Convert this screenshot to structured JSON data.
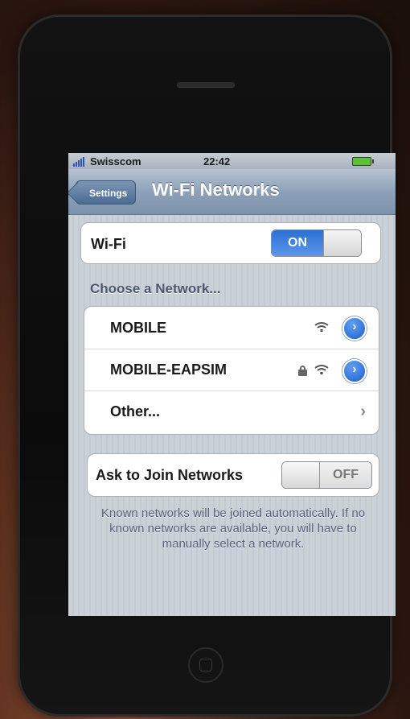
{
  "status_bar": {
    "carrier": "Swisscom",
    "time": "22:42"
  },
  "nav": {
    "back_label": "Settings",
    "title": "Wi-Fi Networks"
  },
  "wifi": {
    "label": "Wi-Fi",
    "toggle_value": "ON"
  },
  "networks": {
    "header": "Choose a Network...",
    "items": [
      {
        "name": "MOBILE",
        "secured": false
      },
      {
        "name": "MOBILE-EAPSIM",
        "secured": true
      },
      {
        "name": "Other..."
      }
    ]
  },
  "ask_to_join": {
    "label": "Ask to Join Networks",
    "toggle_value": "OFF"
  },
  "footer_text": "Known networks will be joined automatically.  If no known networks are available, you will have to manually select a network.",
  "colors": {
    "toggle_on": "#2d6fd4",
    "nav_bar": "#8da1b8",
    "detail_disclosure": "#1f5fc9"
  }
}
